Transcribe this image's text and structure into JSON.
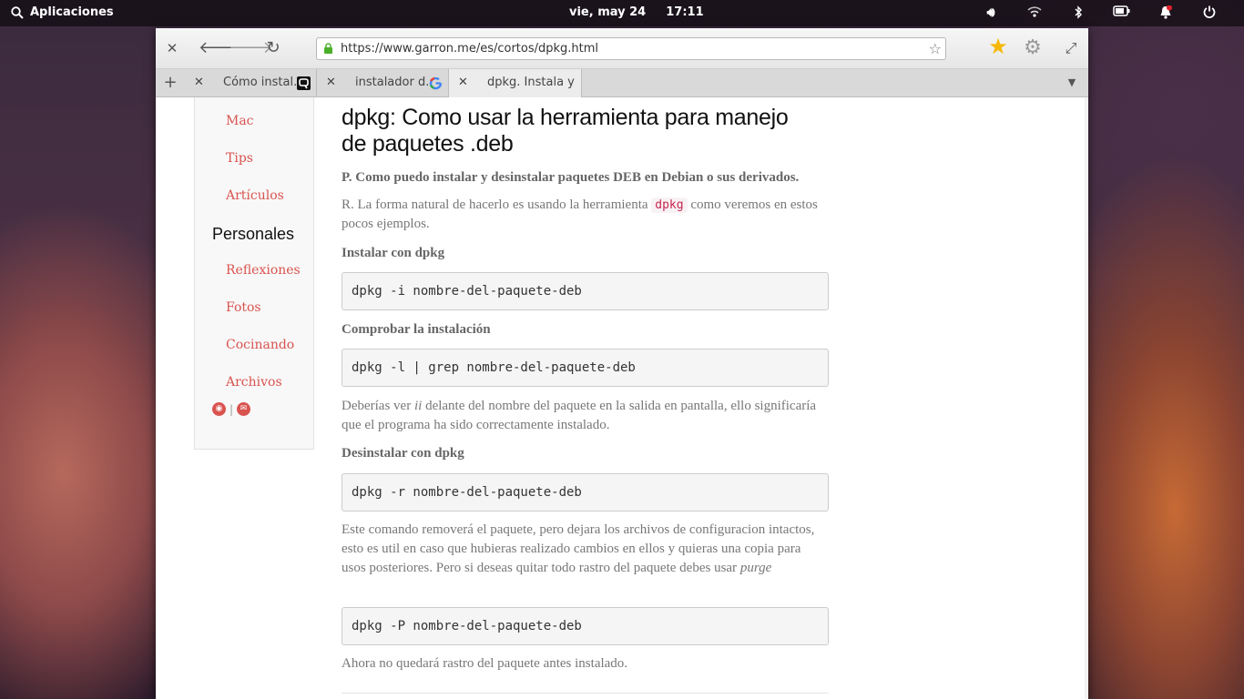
{
  "top_panel": {
    "apps_label": "Aplicaciones",
    "date": "vie, may 24",
    "time": "17:11"
  },
  "browser": {
    "url": "https://www.garron.me/es/cortos/dpkg.html",
    "tabs": [
      {
        "title": "Cómo instal...",
        "active": false
      },
      {
        "title": "instalador d...",
        "active": false
      },
      {
        "title": "dpkg. Instala y ...",
        "active": true
      }
    ]
  },
  "sidebar": {
    "top_links": [
      "Mac",
      "Tips",
      "Artículos"
    ],
    "section_title": "Personales",
    "personal_links": [
      "Reflexiones",
      "Fotos",
      "Cocinando",
      "Archivos"
    ],
    "separator": "|"
  },
  "article": {
    "title": "dpkg: Como usar la herramienta para manejo de paquetes .deb",
    "question": "P. Como puedo instalar y desinstalar paquetes DEB en Debian o sus derivados.",
    "answer_before": "R. La forma natural de hacerlo es usando la herramienta ",
    "answer_code": "dpkg",
    "answer_after": " como veremos en estos pocos ejemplos.",
    "h_install": "Instalar con dpkg",
    "code_install": "dpkg -i nombre-del-paquete-deb",
    "h_check": "Comprobar la instalación",
    "code_check": "dpkg -l | grep nombre-del-paquete-deb",
    "check_before": "Deberías ver ",
    "check_em": "ii",
    "check_after": " delante del nombre del paquete en la salida en pantalla, ello significaría que el programa ha sido correctamente instalado.",
    "h_remove": "Desinstalar con dpkg",
    "code_remove": "dpkg -r nombre-del-paquete-deb",
    "remove_text": "Este comando removerá el paquete, pero dejara los archivos de configuracion intactos, esto es util en caso que hubieras realizado cambios en ellos y quieras una copia para usos posteriores. Pero si deseas quitar todo rastro del paquete debes usar ",
    "remove_em": "purge",
    "code_purge": "dpkg -P nombre-del-paquete-deb",
    "final_text": "Ahora no quedará rastro del paquete antes instalado."
  }
}
